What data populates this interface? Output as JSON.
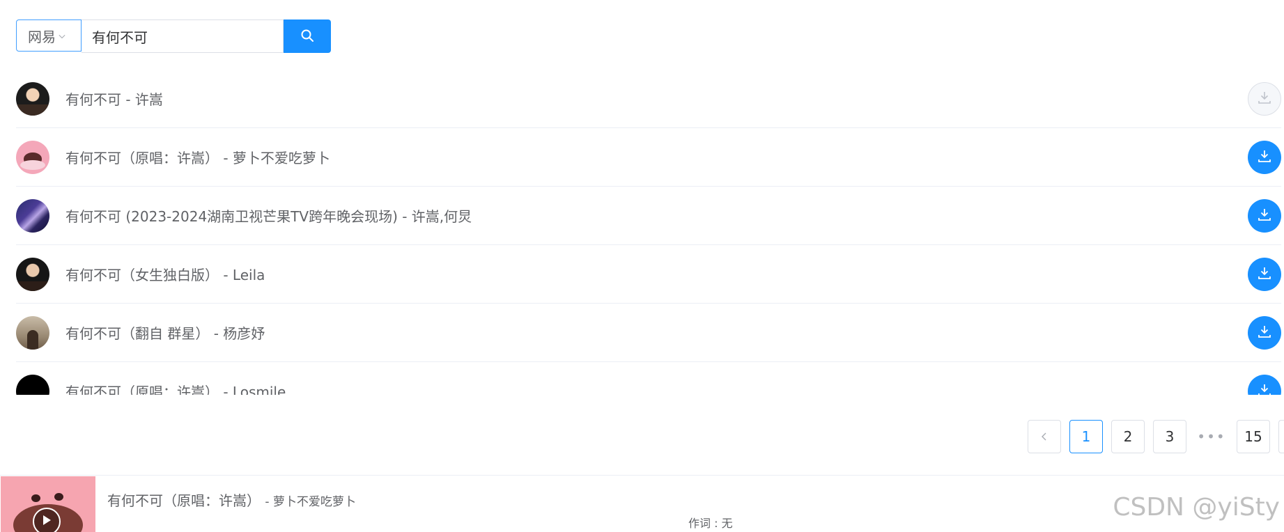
{
  "search": {
    "source": "网易",
    "query": "有何不可"
  },
  "songs": [
    {
      "title": "有何不可 - 许嵩",
      "download_enabled": false
    },
    {
      "title": "有何不可（原唱：许嵩） - 萝卜不爱吃萝卜",
      "download_enabled": true
    },
    {
      "title": "有何不可 (2023-2024湖南卫视芒果TV跨年晚会现场) - 许嵩,何炅",
      "download_enabled": true
    },
    {
      "title": "有何不可（女生独白版） - Leila",
      "download_enabled": true
    },
    {
      "title": "有何不可（翻自 群星） - 杨彦妤",
      "download_enabled": true
    },
    {
      "title": "有何不可（原唱：许嵩） - Losmile",
      "download_enabled": true
    }
  ],
  "pagination": {
    "prev_icon": "chevron-left-icon",
    "pages": [
      "1",
      "2",
      "3"
    ],
    "current": "1",
    "ellipsis": "•••",
    "last": "15"
  },
  "player": {
    "title": "有何不可（原唱：许嵩）",
    "artist": "- 萝卜不爱吃萝卜",
    "lyric": "作词 : 无"
  },
  "watermark": "CSDN @yiSty",
  "colors": {
    "accent": "#1890ff",
    "text": "#606266",
    "border": "#dcdfe6"
  }
}
